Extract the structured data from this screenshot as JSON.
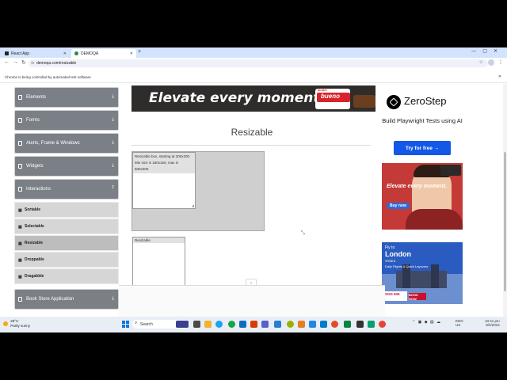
{
  "browser": {
    "tabs": [
      {
        "label": "React App",
        "active": false
      },
      {
        "label": "DEMOQA",
        "active": true
      }
    ],
    "url": "demoqa.com/resizable",
    "infobar": "Chrome is being controlled by automated test software"
  },
  "sidebar": {
    "groups": [
      {
        "label": "Elements",
        "expanded": false
      },
      {
        "label": "Forms",
        "expanded": false
      },
      {
        "label": "Alerts, Frame & Windows",
        "expanded": false
      },
      {
        "label": "Widgets",
        "expanded": false
      },
      {
        "label": "Interactions",
        "expanded": true
      }
    ],
    "interaction_items": [
      {
        "label": "Sortable",
        "active": false
      },
      {
        "label": "Selectable",
        "active": false
      },
      {
        "label": "Resizable",
        "active": true
      },
      {
        "label": "Droppable",
        "active": false
      },
      {
        "label": "Dragabble",
        "active": false
      }
    ],
    "book_store": "Book Store Application"
  },
  "banner": {
    "slogan": "Elevate every moment.",
    "brand_small": "kinder",
    "brand_big": "bueno"
  },
  "main": {
    "title": "Resizable",
    "box_constrained_text": "Resizable box, starting at 200x200. Min size is 150x150, max is 500x300.",
    "box_free_text": "Resizable"
  },
  "ads": {
    "zerostep": {
      "brand": "ZeroStep",
      "tagline": "Build Playwright Tests using AI",
      "cta": "Try for free →"
    },
    "bueno": {
      "message": "Elevate every moment.",
      "cta": "Buy now"
    },
    "london": {
      "fly_to": "Fly to",
      "city": "London",
      "airline": "vistara",
      "schedule": "Daily Flights & Quick Layovers",
      "price": "SGD 605",
      "book": "BOOK NOW"
    }
  },
  "taskbar": {
    "weather_temp": "28°C",
    "weather_desc": "Partly sunny",
    "search_placeholder": "Search",
    "lang_line1": "ENG",
    "lang_line2": "US",
    "time": "10:41 pm",
    "date": "8/2/2024"
  },
  "colors": {
    "sidebar_group": "#7b7f86",
    "accent_blue": "#1358e6",
    "tab_strip": "#d3e3fd"
  }
}
